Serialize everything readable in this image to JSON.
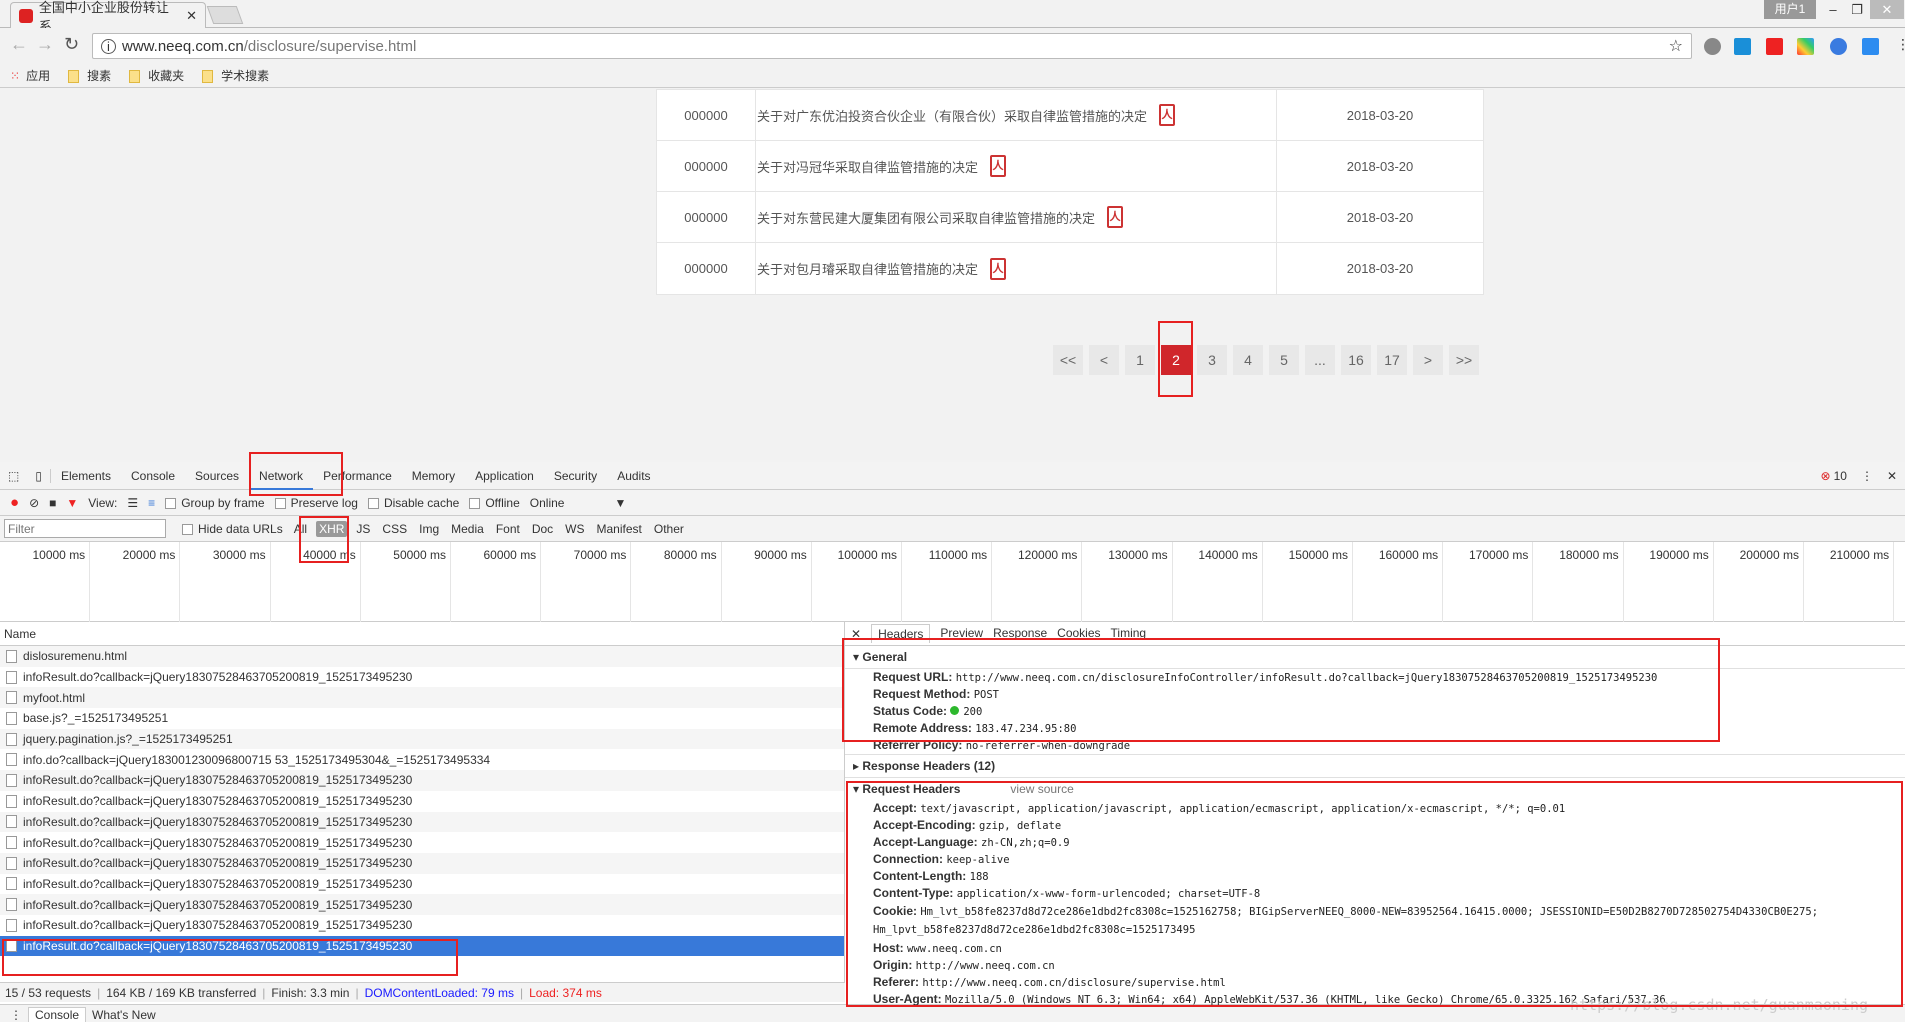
{
  "browser": {
    "tab_title": "全国中小企业股份转让系",
    "user_label": "用户1",
    "url_host": "www.neeq.com.cn",
    "url_path": "/disclosure/supervise.html",
    "bookmarks": [
      "应用",
      "搜素",
      "收藏夹",
      "学术搜素"
    ]
  },
  "page": {
    "rows": [
      {
        "code": "000000",
        "title": "关于对广东优泊投资合伙企业（有限合伙）采取自律监管措施的决定",
        "date": "2018-03-20"
      },
      {
        "code": "000000",
        "title": "关于对冯冠华采取自律监管措施的决定",
        "date": "2018-03-20"
      },
      {
        "code": "000000",
        "title": "关于对东营民建大厦集团有限公司采取自律监管措施的决定",
        "date": "2018-03-20"
      },
      {
        "code": "000000",
        "title": "关于对包月璿采取自律监管措施的决定",
        "date": "2018-03-20"
      }
    ],
    "pagination": [
      "<<",
      "<",
      "1",
      "2",
      "3",
      "4",
      "5",
      "...",
      "16",
      "17",
      ">",
      ">>"
    ],
    "current_page": "2"
  },
  "devtools": {
    "tabs": [
      "Elements",
      "Console",
      "Sources",
      "Network",
      "Performance",
      "Memory",
      "Application",
      "Security",
      "Audits"
    ],
    "active_tab": "Network",
    "error_count": "10",
    "toolbar": {
      "view": "View:",
      "group_by_frame": "Group by frame",
      "preserve_log": "Preserve log",
      "disable_cache": "Disable cache",
      "offline": "Offline",
      "throttle": "Online"
    },
    "filter_placeholder": "Filter",
    "hide_data_urls": "Hide data URLs",
    "types": [
      "All",
      "XHR",
      "JS",
      "CSS",
      "Img",
      "Media",
      "Font",
      "Doc",
      "WS",
      "Manifest",
      "Other"
    ],
    "selected_type": "XHR",
    "timeline_ticks": [
      "10000 ms",
      "20000 ms",
      "30000 ms",
      "40000 ms",
      "50000 ms",
      "60000 ms",
      "70000 ms",
      "80000 ms",
      "90000 ms",
      "100000 ms",
      "110000 ms",
      "120000 ms",
      "130000 ms",
      "140000 ms",
      "150000 ms",
      "160000 ms",
      "170000 ms",
      "180000 ms",
      "190000 ms",
      "200000 ms",
      "210000 ms"
    ],
    "list_header": "Name",
    "requests": [
      "dislosuremenu.html",
      "infoResult.do?callback=jQuery18307528463705200819_1525173495230",
      "myfoot.html",
      "base.js?_=1525173495251",
      "jquery.pagination.js?_=1525173495251",
      "info.do?callback=jQuery183001230096800715 53_1525173495304&_=1525173495334",
      "infoResult.do?callback=jQuery18307528463705200819_1525173495230",
      "infoResult.do?callback=jQuery18307528463705200819_1525173495230",
      "infoResult.do?callback=jQuery18307528463705200819_1525173495230",
      "infoResult.do?callback=jQuery18307528463705200819_1525173495230",
      "infoResult.do?callback=jQuery18307528463705200819_1525173495230",
      "infoResult.do?callback=jQuery18307528463705200819_1525173495230",
      "infoResult.do?callback=jQuery18307528463705200819_1525173495230",
      "infoResult.do?callback=jQuery18307528463705200819_1525173495230",
      "infoResult.do?callback=jQuery18307528463705200819_1525173495230"
    ],
    "status": {
      "requests": "15 / 53 requests",
      "transferred": "164 KB / 169 KB transferred",
      "finish": "Finish: 3.3 min",
      "dcl": "DOMContentLoaded: 79 ms",
      "load": "Load: 374 ms"
    },
    "drawer_tabs": [
      "Console",
      "What's New"
    ],
    "detail_tabs": [
      "Headers",
      "Preview",
      "Response",
      "Cookies",
      "Timing"
    ],
    "general": {
      "title": "General",
      "items": [
        {
          "k": "Request URL:",
          "v": "http://www.neeq.com.cn/disclosureInfoController/infoResult.do?callback=jQuery18307528463705200819_1525173495230"
        },
        {
          "k": "Request Method:",
          "v": "POST"
        },
        {
          "k": "Status Code:",
          "v": "200"
        },
        {
          "k": "Remote Address:",
          "v": "183.47.234.95:80"
        },
        {
          "k": "Referrer Policy:",
          "v": "no-referrer-when-downgrade"
        }
      ]
    },
    "response_headers": "Response Headers (12)",
    "request_headers": {
      "title": "Request Headers",
      "view_source": "view source",
      "items": [
        {
          "k": "Accept:",
          "v": "text/javascript, application/javascript, application/ecmascript, application/x-ecmascript, */*; q=0.01"
        },
        {
          "k": "Accept-Encoding:",
          "v": "gzip, deflate"
        },
        {
          "k": "Accept-Language:",
          "v": "zh-CN,zh;q=0.9"
        },
        {
          "k": "Connection:",
          "v": "keep-alive"
        },
        {
          "k": "Content-Length:",
          "v": "188"
        },
        {
          "k": "Content-Type:",
          "v": "application/x-www-form-urlencoded; charset=UTF-8"
        },
        {
          "k": "Cookie:",
          "v": "Hm_lvt_b58fe8237d8d72ce286e1dbd2fc8308c=1525162758; BIGipServerNEEQ_8000-NEW=83952564.16415.0000; JSESSIONID=E50D2B8270D728502754D4330CB0E275; Hm_lpvt_b58fe8237d8d72ce286e1dbd2fc8308c=1525173495"
        },
        {
          "k": "Host:",
          "v": "www.neeq.com.cn"
        },
        {
          "k": "Origin:",
          "v": "http://www.neeq.com.cn"
        },
        {
          "k": "Referer:",
          "v": "http://www.neeq.com.cn/disclosure/supervise.html"
        },
        {
          "k": "User-Agent:",
          "v": "Mozilla/5.0 (Windows NT 6.3; Win64; x64) AppleWebKit/537.36 (KHTML, like Gecko) Chrome/65.0.3325.162 Safari/537.36"
        }
      ]
    },
    "watermark": "https://blog.csdn.net/guanmaoning"
  },
  "colors": {
    "accent": "#3879d9",
    "page_active": "#d0262b",
    "annotation": "#e62020",
    "status_ok": "#2db82d"
  }
}
